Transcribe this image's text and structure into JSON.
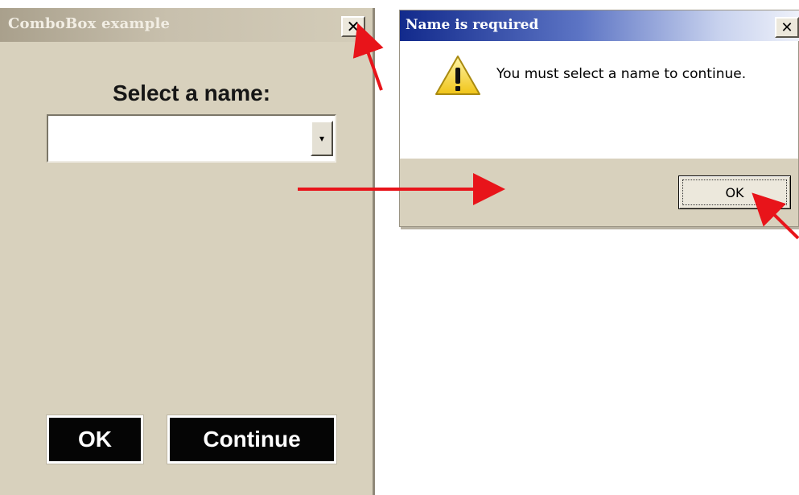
{
  "left_window": {
    "title": "ComboBox example",
    "close_glyph": "✕",
    "select_label": "Select a name:",
    "combo": {
      "value": "",
      "dropdown_glyph": "▾"
    },
    "ok_button": "OK",
    "continue_button": "Continue"
  },
  "message_box": {
    "title": "Name is required",
    "close_glyph": "✕",
    "icon": "warning-icon",
    "message": "You must select a name to continue.",
    "ok_button": "OK"
  },
  "colors": {
    "window_face": "#d8d1bd",
    "message_titlebar": "#122a8c",
    "annotation_arrow": "#e8141a",
    "button_dark": "#050505"
  }
}
